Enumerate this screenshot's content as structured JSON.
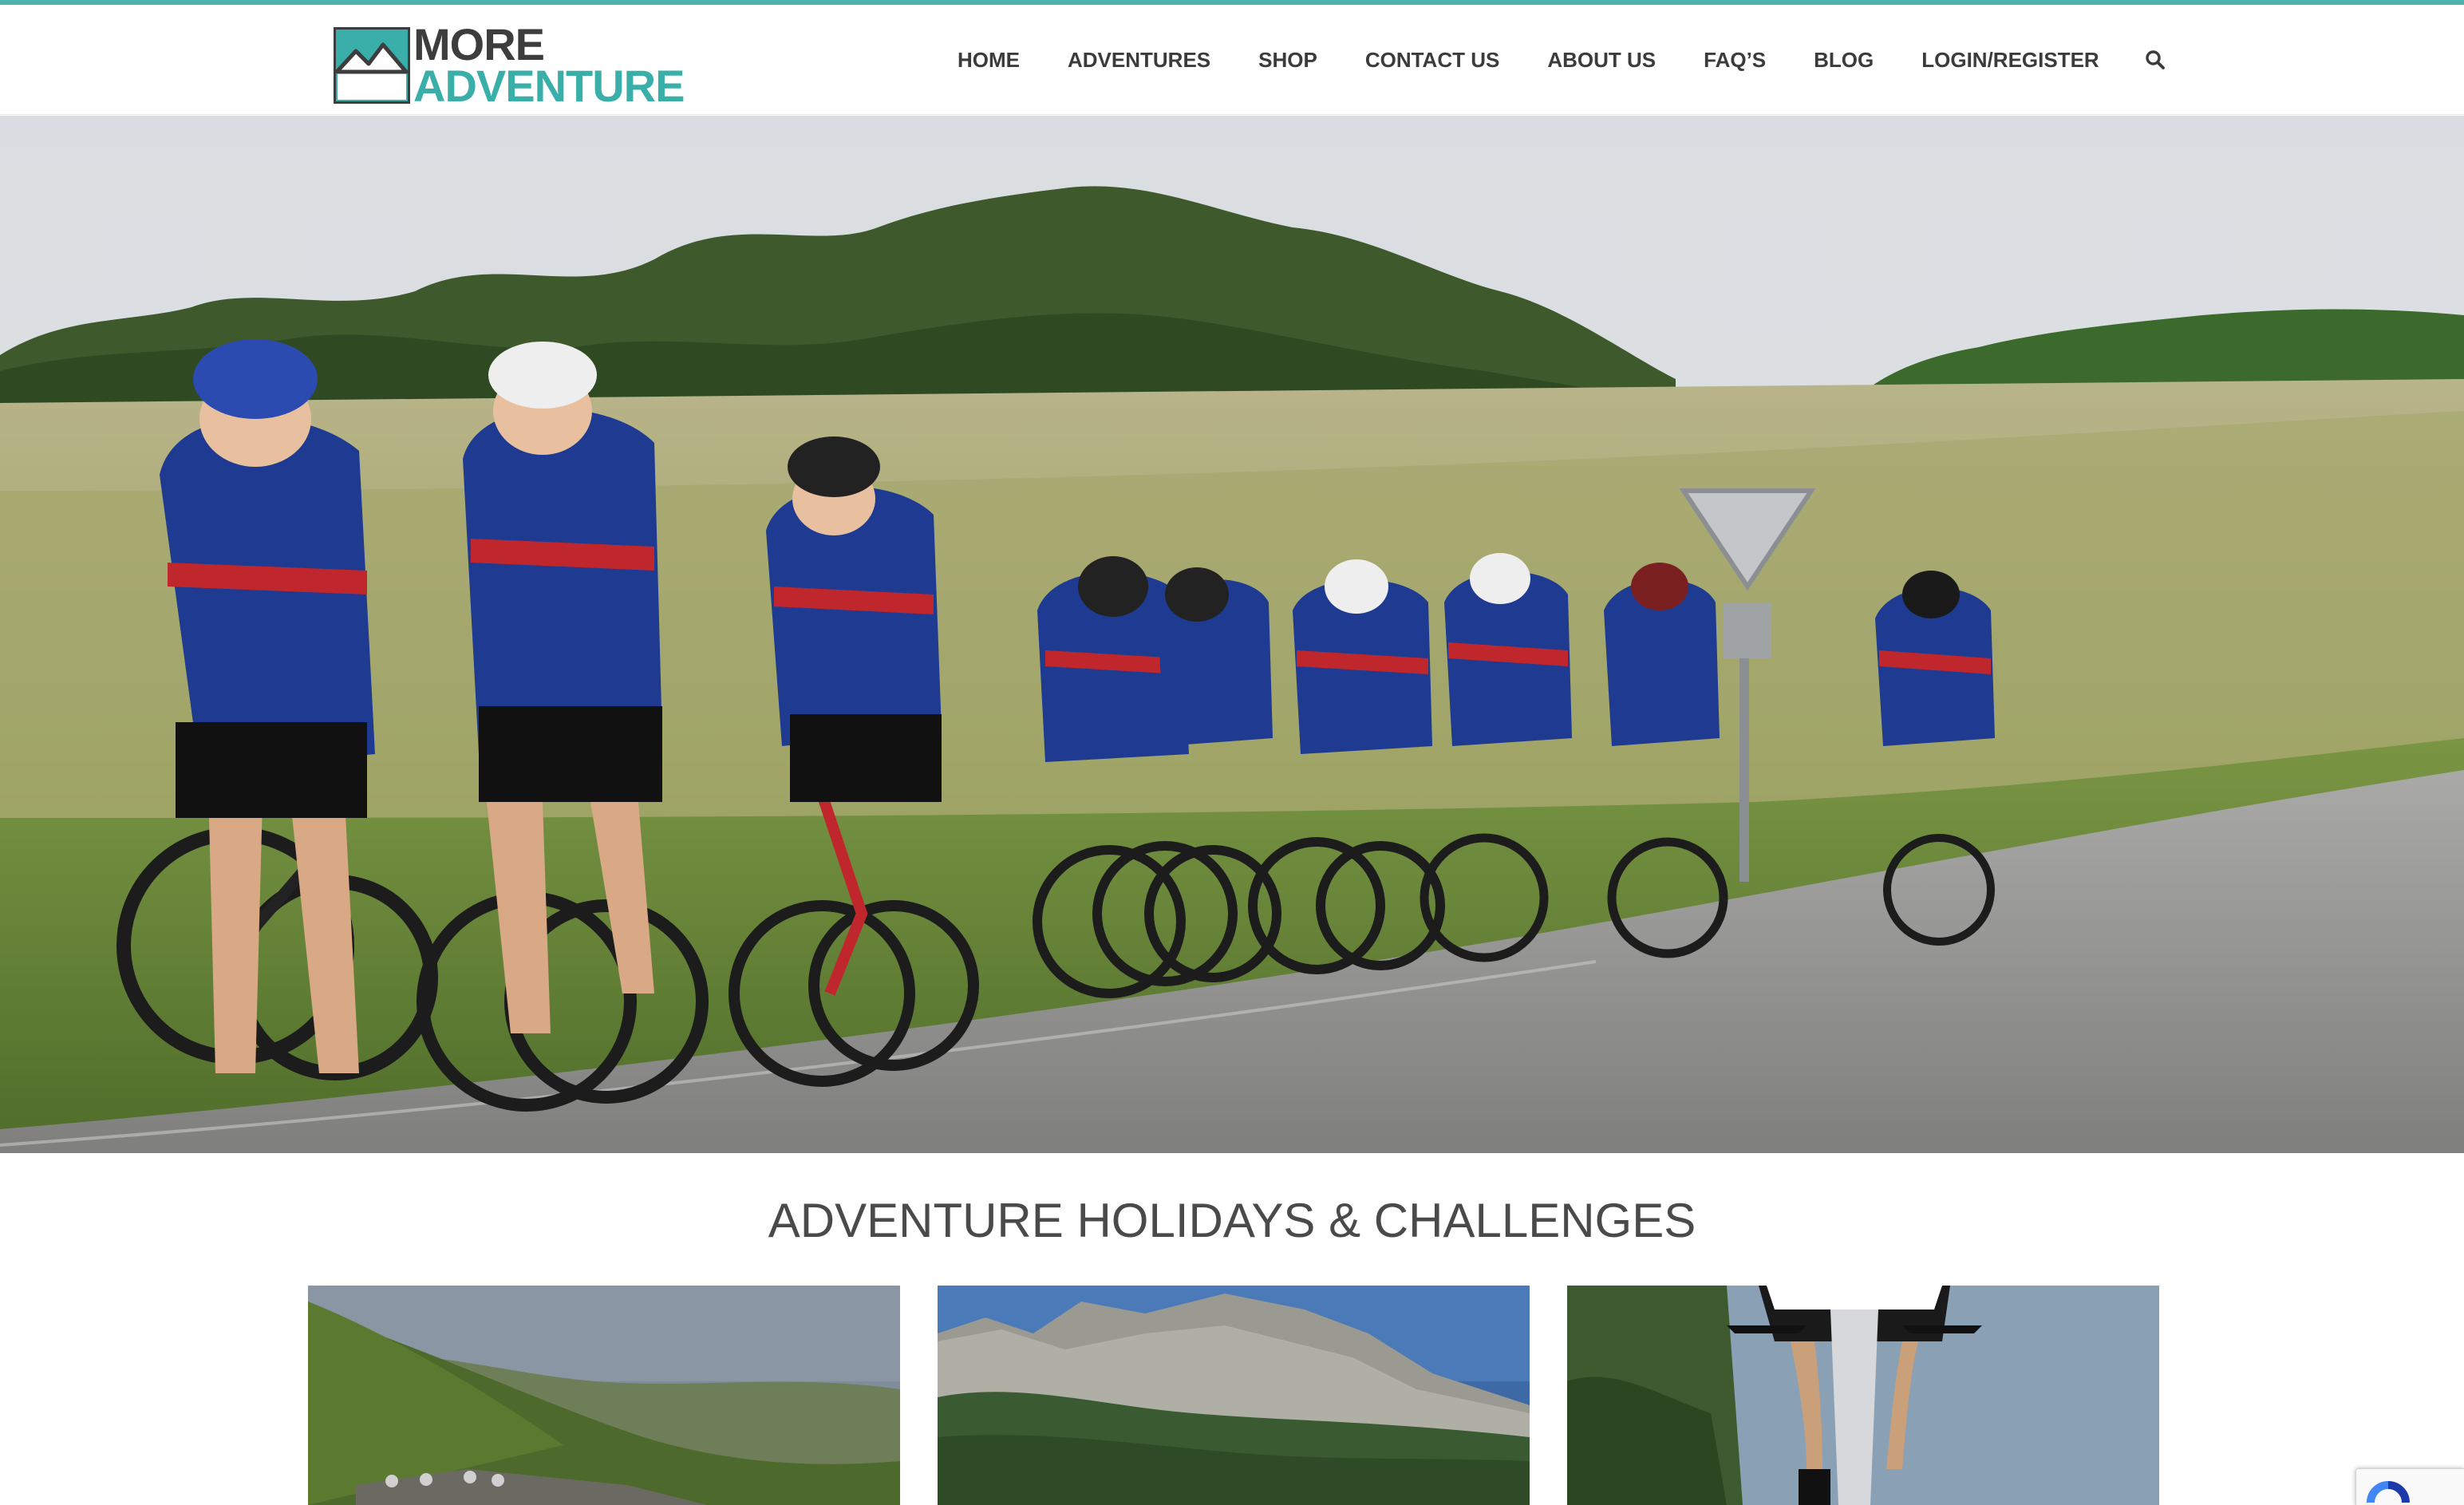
{
  "brand": {
    "logo_line1": "MORE",
    "logo_line2": "ADVENTURE",
    "accent_color": "#3aafa9",
    "dark_color": "#3d3d3d"
  },
  "nav": {
    "items": [
      {
        "label": "HOME"
      },
      {
        "label": "ADVENTURES"
      },
      {
        "label": "SHOP"
      },
      {
        "label": "CONTACT US"
      },
      {
        "label": "ABOUT US"
      },
      {
        "label": "FAQ’S"
      },
      {
        "label": "BLOG"
      },
      {
        "label": "LOGIN/REGISTER"
      }
    ],
    "search_icon": "search-icon"
  },
  "hero": {
    "image": "group-of-road-cyclists-riding-on-country-road"
  },
  "section": {
    "title": "ADVENTURE HOLIDAYS & CHALLENGES"
  },
  "cards": [
    {
      "image": "cyclists-in-green-hills-valley"
    },
    {
      "image": "rocky-mountain-peaks"
    },
    {
      "image": "cyclist-front-view-on-bike"
    }
  ],
  "widgets": {
    "recaptcha_icon": "recaptcha-icon"
  }
}
